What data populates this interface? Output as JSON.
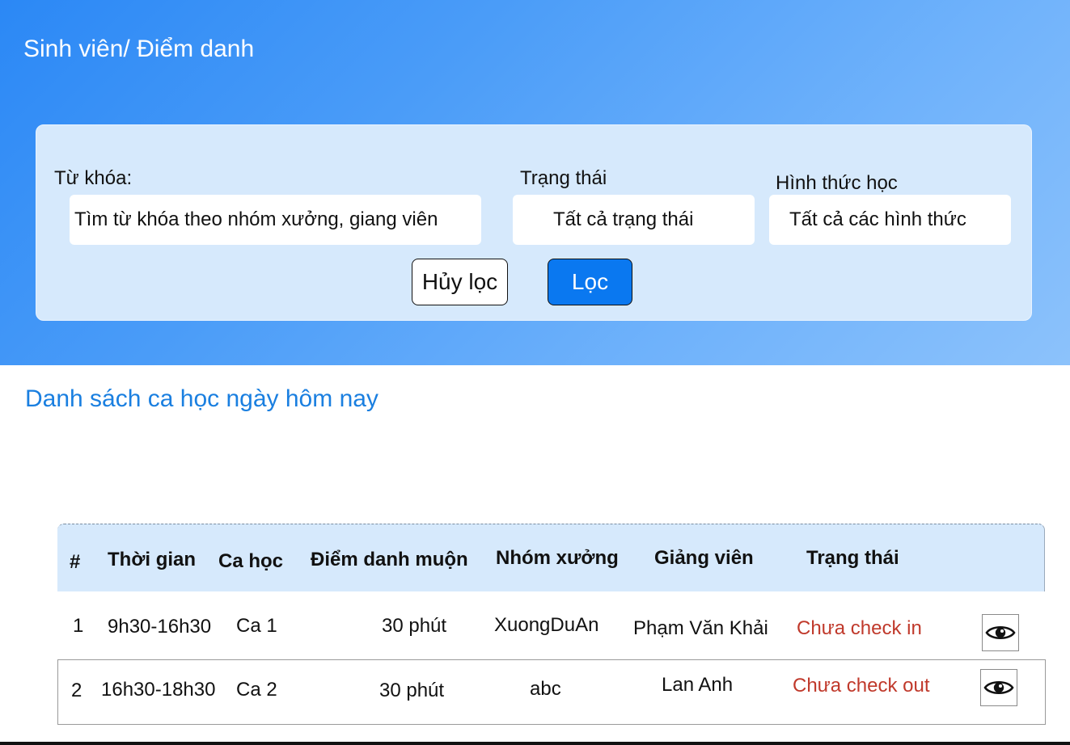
{
  "header": {
    "breadcrumb": "Sinh viên/ Điểm danh"
  },
  "filter": {
    "keyword_label": "Từ khóa:",
    "keyword_placeholder": "Tìm từ khóa theo nhóm xưởng, giang viên",
    "status_label": "Trạng thái",
    "status_value": "Tất cả trạng thái",
    "mode_label": "Hình thức học",
    "mode_value": "Tất cả các hình thức",
    "reset_label": "Hủy lọc",
    "apply_label": "Lọc"
  },
  "section": {
    "title": "Danh sách ca học ngày hôm nay"
  },
  "table": {
    "headers": [
      "#",
      "Thời gian",
      "Ca học",
      "Điểm danh muộn",
      "Nhóm xưởng",
      "Giảng viên",
      "Trạng thái"
    ],
    "rows": [
      {
        "index": "1",
        "time": "9h30-16h30",
        "shift": "Ca 1",
        "late": "30 phút",
        "group": "XuongDuAn",
        "lecturer": "Phạm Văn Khải",
        "status": "Chưa check in",
        "action_icon": "eye-icon"
      },
      {
        "index": "2",
        "time": "16h30-18h30",
        "shift": "Ca 2",
        "late": "30 phút",
        "group": "abc",
        "lecturer": "Lan Anh",
        "status": "Chưa check out",
        "action_icon": "eye-icon"
      }
    ]
  },
  "colors": {
    "accent": "#1a7fe0",
    "primary_button": "#0a78f0",
    "status_red": "#c0392b",
    "filter_panel": "#d6e9fc"
  }
}
